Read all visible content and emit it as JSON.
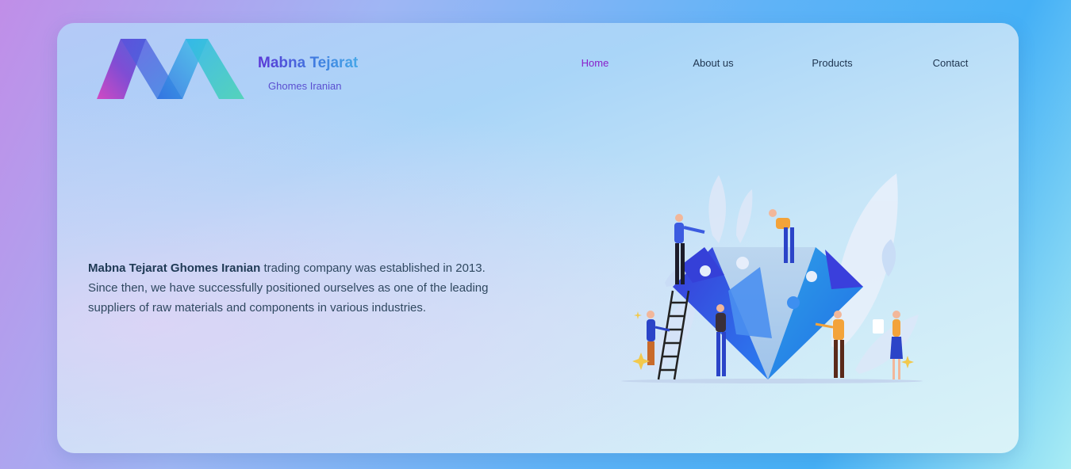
{
  "brand": {
    "title": "Mabna Tejarat",
    "subtitle": "Ghomes Iranian"
  },
  "nav": {
    "items": [
      {
        "label": "Home",
        "active": true
      },
      {
        "label": "About us",
        "active": false
      },
      {
        "label": "Products",
        "active": false
      },
      {
        "label": "Contact",
        "active": false
      }
    ]
  },
  "hero": {
    "company_name": "Mabna Tejarat Ghomes Iranian",
    "text_part1": " trading company was established in 2013.",
    "text_part2": "Since then, we have successfully positioned ourselves as one of the leading suppliers of raw materials and components in various industries."
  },
  "illustration": {
    "icon": "teamwork-puzzle-illustration"
  },
  "colors": {
    "accent_active": "#8a1fc9",
    "nav_text": "#1f3550",
    "brand_gradient_start": "#5b35d6",
    "brand_gradient_end": "#46a7e8",
    "body_text": "#2f4860"
  }
}
